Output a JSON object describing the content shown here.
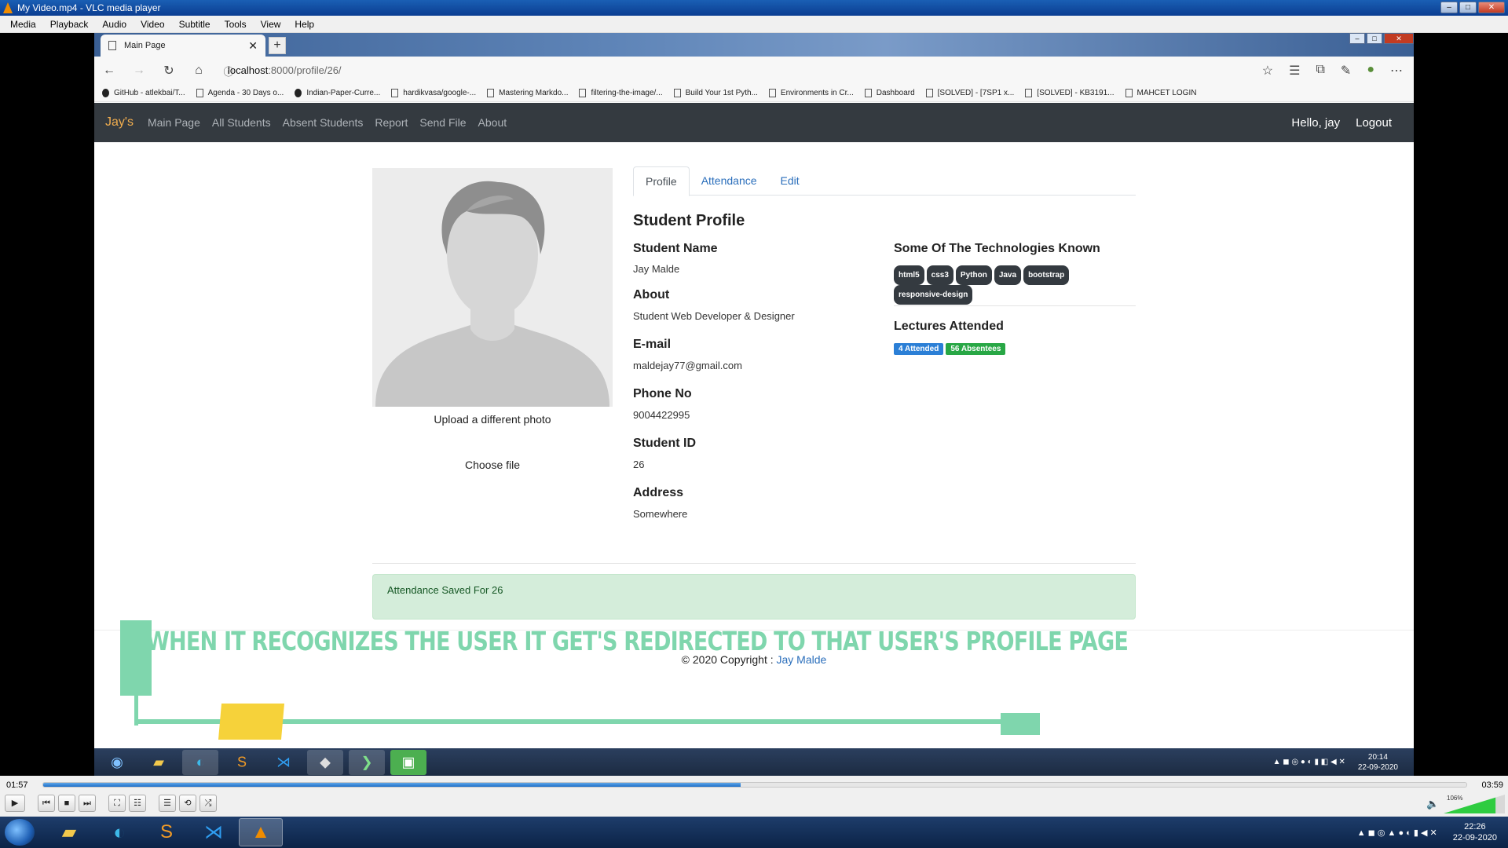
{
  "vlc": {
    "title": "My Video.mp4 - VLC media player",
    "menu": [
      "Media",
      "Playback",
      "Audio",
      "Video",
      "Subtitle",
      "Tools",
      "View",
      "Help"
    ],
    "time_current": "01:57",
    "time_total": "03:59",
    "progress": 0.49,
    "volume_label": "106%"
  },
  "browser": {
    "tab_title": "Main Page",
    "url_host": "localhost",
    "url_path": ":8000/profile/26/",
    "bookmarks": [
      "GitHub - atlekbai/T...",
      "Agenda - 30 Days o...",
      "Indian-Paper-Curre...",
      "hardikvasa/google-...",
      "Mastering Markdo...",
      "filtering-the-image/...",
      "Build Your 1st Pyth...",
      "Environments in Cr...",
      "Dashboard",
      "[SOLVED] - [7SP1 x...",
      "[SOLVED] - KB3191...",
      "MAHCET LOGIN"
    ]
  },
  "navbar": {
    "brand": "Jay's",
    "links": [
      "Main Page",
      "All Students",
      "Absent Students",
      "Report",
      "Send File",
      "About"
    ],
    "greeting": "Hello, jay",
    "logout": "Logout"
  },
  "profile": {
    "upload_label": "Upload a different photo",
    "choose_file": "Choose file",
    "tabs": [
      "Profile",
      "Attendance",
      "Edit"
    ],
    "heading": "Student Profile",
    "fields": [
      {
        "label": "Student Name",
        "value": "Jay Malde"
      },
      {
        "label": "About",
        "value": "Student Web Developer & Designer"
      },
      {
        "label": "E-mail",
        "value": "maldejay77@gmail.com"
      },
      {
        "label": "Phone No",
        "value": "9004422995"
      },
      {
        "label": "Student ID",
        "value": "26"
      },
      {
        "label": "Address",
        "value": "Somewhere"
      }
    ],
    "tech_heading": "Some Of The Technologies Known",
    "tech_badges": [
      "html5",
      "css3",
      "Python",
      "Java",
      "bootstrap",
      "responsive-design"
    ],
    "lectures_heading": "Lectures Attended",
    "attended_badge": "4 Attended",
    "absent_badge": "56 Absentees",
    "alert": "Attendance Saved For 26"
  },
  "footer": {
    "copyright": "© 2020 Copyright :",
    "author": "Jay Malde"
  },
  "overlay_caption": "WHEN IT RECOGNIZES  THE USER IT GET'S REDIRECTED TO THAT USER'S PROFILE PAGE",
  "inner_clock": {
    "time": "20:14",
    "date": "22-09-2020"
  },
  "clock": {
    "time": "22:26",
    "date": "22-09-2020"
  },
  "colors": {
    "navbar_bg": "#343a40",
    "brand": "#f0ad4e",
    "link": "#2a6ebb",
    "alert_bg": "#d4edda",
    "caption": "#7fd6ad",
    "badge_attended": "#2b7fd6",
    "badge_absent": "#28a745"
  }
}
